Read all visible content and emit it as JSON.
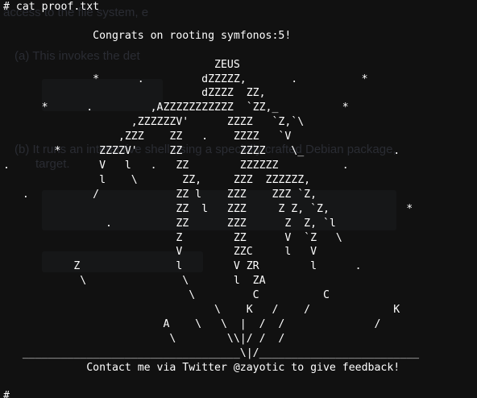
{
  "background_color": "#111111",
  "text_color": "#ffffff",
  "background_text": {
    "line1": "access to the file system, e",
    "line2": "(a)  This invokes the det",
    "line3": "(b)  It runs an interactive shell using a specially crafted Debian package,",
    "line4": "target."
  },
  "terminal_lines": [
    "# cat proof.txt",
    "",
    "              Congrats on rooting symfonos:5!",
    "",
    "                                 ZEUS",
    "              *      .         dZZZZZ,       .          *",
    "                               dZZZZ  ZZ,",
    "      *      .         ,AZZZZZZZZZZZ  `ZZ,_          *",
    "                    ,ZZZZZZV'      ZZZZ   `Z,`\\",
    "                  ,ZZZ    ZZ   .    ZZZZ   `V",
    "        *      ZZZZV'     ZZ         ZZZZ    \\_              .",
    ".              V   l   .   ZZ        ZZZZZZ          .",
    "               l    \\       ZZ,     ZZZ  ZZZZZZ,",
    "   .          /            ZZ l    ZZZ    ZZZ `Z,",
    "                           ZZ  l   ZZZ     Z Z, `Z,            *",
    "                .          ZZ      ZZZ      Z  Z, `l",
    "                           Z        ZZ      V  `Z   \\",
    "                           V        ZZC     l   V",
    "           Z               l        V ZR        l      .",
    "            \\               \\       l  ZA",
    "                             \\         C          C",
    "                                 \\    K   /    /             K",
    "                         A    \\   \\  |  /  /              /",
    "                          \\        \\\\|/ /  /",
    "   __________________________________\\|/_________________________",
    "             Contact me via Twitter @zayotic to give feedback!",
    "",
    "#"
  ]
}
